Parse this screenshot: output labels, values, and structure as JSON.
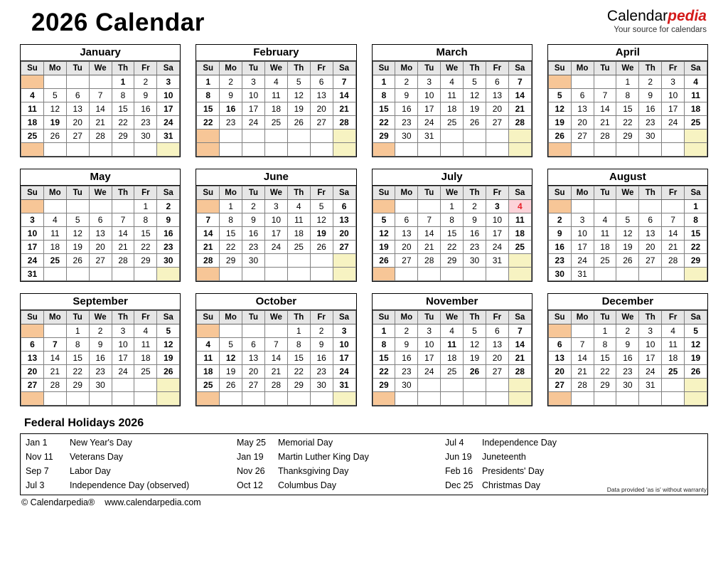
{
  "header": {
    "title": "2026 Calendar",
    "brand_black": "Calendar",
    "brand_red": "pedia",
    "tagline": "Your source for calendars"
  },
  "colors": {
    "sunday_bg": "#f7c697",
    "saturday_bg": "#f7f3c2",
    "weekday_header_bg": "#e6e6e6",
    "holiday_bg": "#fcd3d9",
    "holiday_text": "#e8202a",
    "brand_red": "#d41a1a"
  },
  "weekday_headers": [
    "Su",
    "Mo",
    "Tu",
    "We",
    "Th",
    "Fr",
    "Sa"
  ],
  "months": [
    {
      "name": "January",
      "first_weekday": 4,
      "days": 31,
      "holidays": [
        1,
        19
      ]
    },
    {
      "name": "February",
      "first_weekday": 0,
      "days": 28,
      "holidays": [
        16
      ]
    },
    {
      "name": "March",
      "first_weekday": 0,
      "days": 31,
      "holidays": []
    },
    {
      "name": "April",
      "first_weekday": 3,
      "days": 30,
      "holidays": []
    },
    {
      "name": "May",
      "first_weekday": 5,
      "days": 31,
      "holidays": [
        25
      ]
    },
    {
      "name": "June",
      "first_weekday": 1,
      "days": 30,
      "holidays": [
        19
      ]
    },
    {
      "name": "July",
      "first_weekday": 3,
      "days": 31,
      "holidays": [
        3,
        4
      ]
    },
    {
      "name": "August",
      "first_weekday": 6,
      "days": 31,
      "holidays": []
    },
    {
      "name": "September",
      "first_weekday": 2,
      "days": 30,
      "holidays": [
        7
      ]
    },
    {
      "name": "October",
      "first_weekday": 4,
      "days": 31,
      "holidays": [
        12
      ]
    },
    {
      "name": "November",
      "first_weekday": 0,
      "days": 30,
      "holidays": [
        11,
        26
      ]
    },
    {
      "name": "December",
      "first_weekday": 2,
      "days": 31,
      "holidays": [
        25
      ]
    }
  ],
  "holidays_section": {
    "title": "Federal Holidays 2026",
    "rows": [
      [
        {
          "date": "Jan 1",
          "name": "New Year's Day"
        },
        {
          "date": "May 25",
          "name": "Memorial Day"
        },
        {
          "date": "Jul 4",
          "name": "Independence Day"
        },
        {
          "date": "Nov 11",
          "name": "Veterans Day"
        }
      ],
      [
        {
          "date": "Jan 19",
          "name": "Martin Luther King Day"
        },
        {
          "date": "Jun 19",
          "name": "Juneteenth"
        },
        {
          "date": "Sep 7",
          "name": "Labor Day"
        },
        {
          "date": "Nov 26",
          "name": "Thanksgiving Day"
        }
      ],
      [
        {
          "date": "Feb 16",
          "name": "Presidents' Day"
        },
        {
          "date": "Jul 3",
          "name": "Independence Day (observed)"
        },
        {
          "date": "Oct 12",
          "name": "Columbus Day"
        },
        {
          "date": "Dec 25",
          "name": "Christmas Day"
        }
      ]
    ]
  },
  "footer": {
    "copyright": "© Calendarpedia®",
    "website": "www.calendarpedia.com",
    "disclaimer": "Data provided 'as is' without warranty"
  }
}
